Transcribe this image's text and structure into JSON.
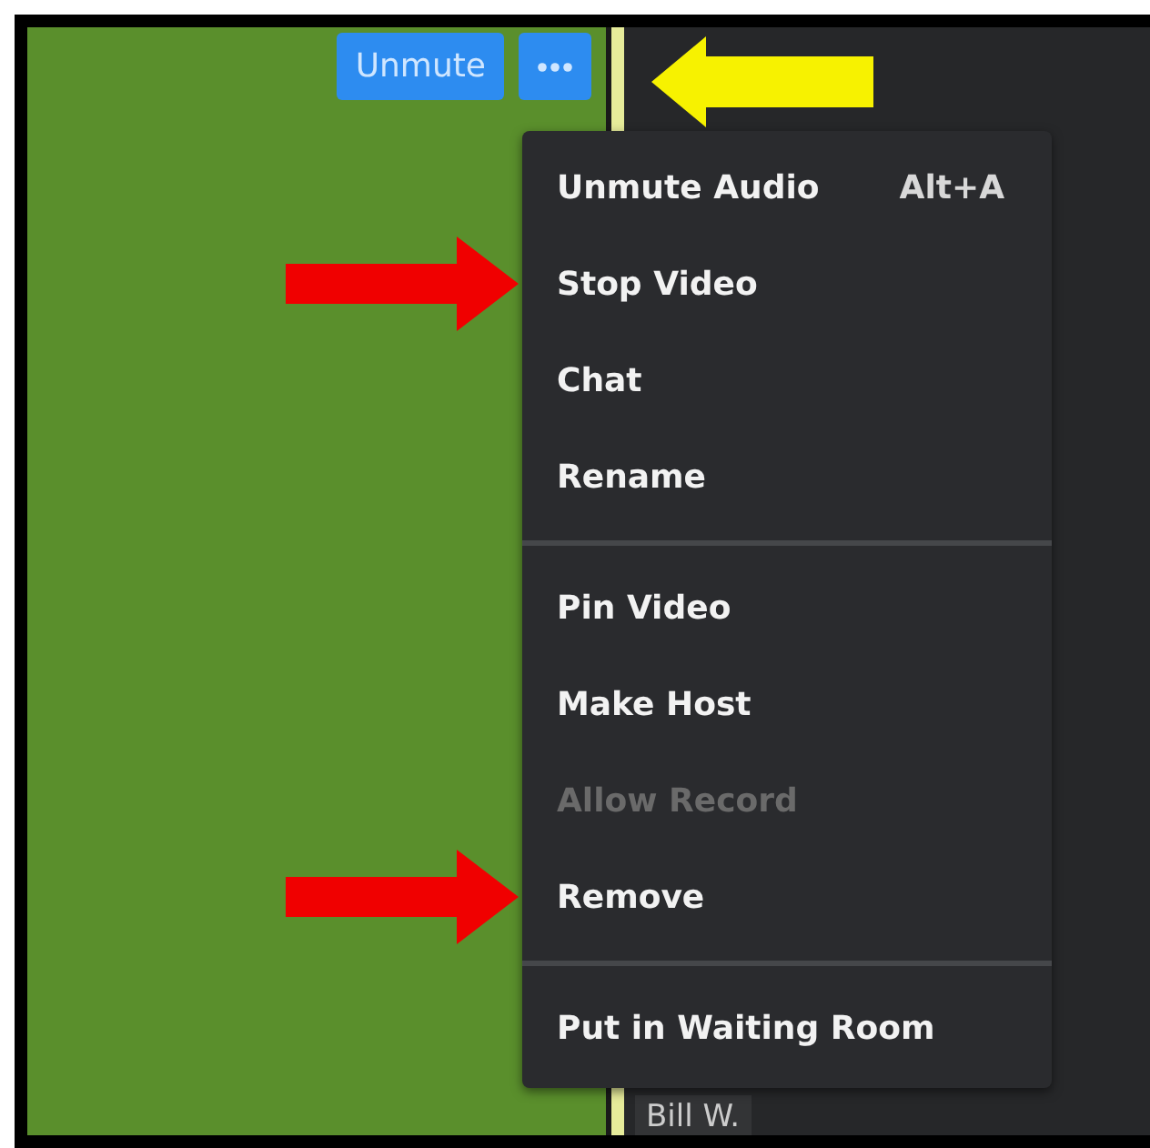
{
  "toolbar": {
    "unmute_button": {
      "label": "Unmute"
    },
    "more_button": {
      "marked": true
    }
  },
  "menu": {
    "items": [
      {
        "kind": "item",
        "label": "Unmute Audio",
        "shortcut": "Alt+A",
        "disabled": false,
        "marked": false
      },
      {
        "kind": "item",
        "label": "Stop Video",
        "disabled": false,
        "marked": true
      },
      {
        "kind": "item",
        "label": "Chat",
        "disabled": false,
        "marked": false
      },
      {
        "kind": "item",
        "label": "Rename",
        "disabled": false,
        "marked": false
      },
      {
        "kind": "separator"
      },
      {
        "kind": "item",
        "label": "Pin Video",
        "disabled": false,
        "marked": false
      },
      {
        "kind": "item",
        "label": "Make Host",
        "disabled": false,
        "marked": false
      },
      {
        "kind": "item",
        "label": "Allow Record",
        "disabled": true,
        "marked": false
      },
      {
        "kind": "item",
        "label": "Remove",
        "disabled": false,
        "marked": true
      },
      {
        "kind": "separator"
      },
      {
        "kind": "item",
        "label": "Put in Waiting Room",
        "disabled": false,
        "marked": false
      }
    ]
  },
  "participant": {
    "name": "Bill W."
  }
}
